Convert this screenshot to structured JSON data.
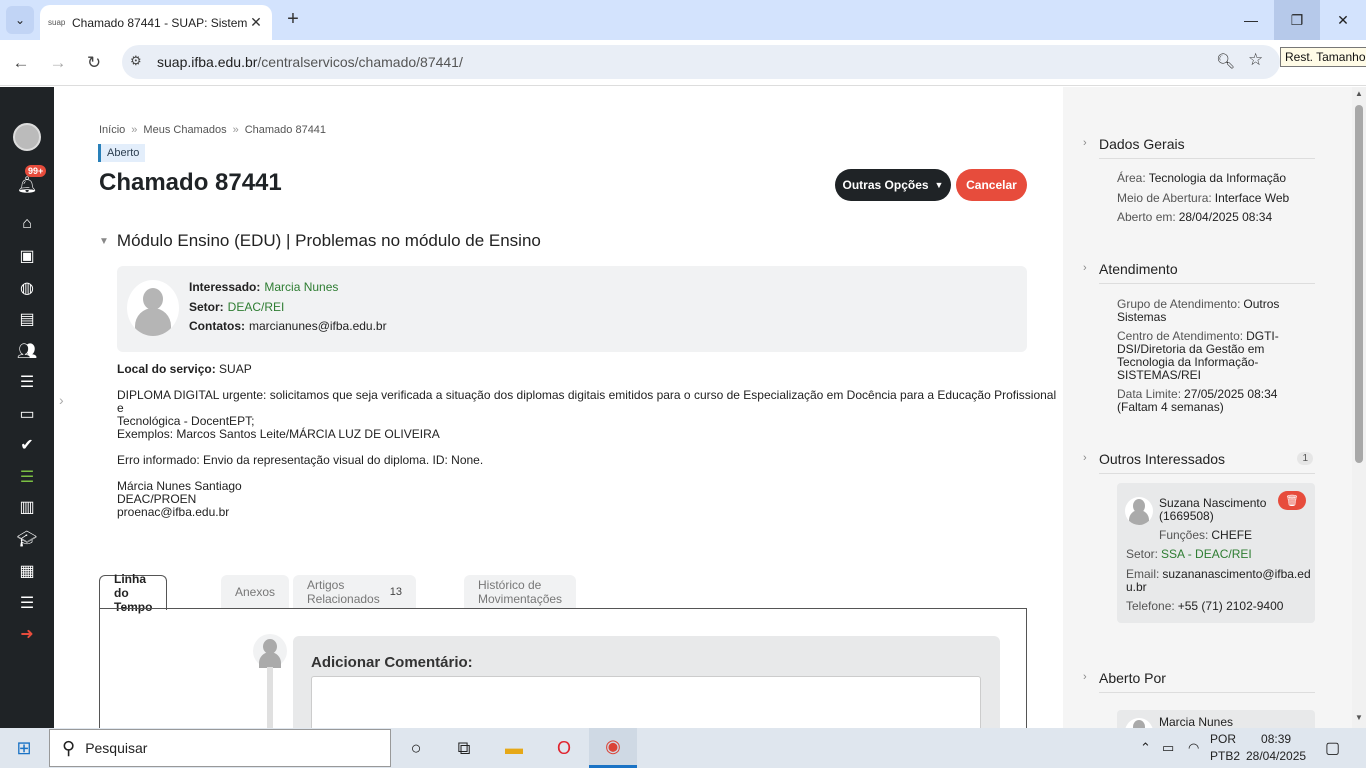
{
  "browser": {
    "tab_title": "Chamado 87441 - SUAP: Sistem",
    "favicon_text": "suap",
    "url_host": "suap.ifba.edu.br",
    "url_path": "/centralservicos/chamado/87441/",
    "tooltip": "Rest. Tamanho"
  },
  "sidebar": {
    "notification_badge": "99+"
  },
  "breadcrumb": {
    "items": [
      "Início",
      "Meus Chamados",
      "Chamado 87441"
    ]
  },
  "status": "Aberto",
  "title": "Chamado 87441",
  "actions": {
    "options_label": "Outras Opções",
    "cancel_label": "Cancelar"
  },
  "section_title": "Módulo Ensino (EDU) | Problemas no módulo de Ensino",
  "requester": {
    "interessado_label": "Interessado:",
    "interessado": "Marcia Nunes",
    "setor_label": "Setor:",
    "setor": "DEAC/REI",
    "contatos_label": "Contatos:",
    "contatos": "marcianunes@ifba.edu.br"
  },
  "description": {
    "local_label": "Local do serviço:",
    "local": "SUAP",
    "p1_line1": "DIPLOMA DIGITAL urgente: solicitamos que seja verificada a situação dos diplomas digitais emitidos para o curso de Especialização em Docência para a Educação Profissional e",
    "p1_line2": "Tecnológica - DocentEPT;",
    "p2": "Exemplos: Marcos Santos Leite/MÁRCIA LUZ DE OLIVEIRA",
    "p3": "Erro informado: Envio da representação visual do diploma. ID: None.",
    "sig1": "Márcia Nunes Santiago",
    "sig2": "DEAC/PROEN",
    "sig3": "proenac@ifba.edu.br"
  },
  "tabs": [
    {
      "label": "Linha do Tempo"
    },
    {
      "label": "Anexos"
    },
    {
      "label": "Artigos Relacionados",
      "count": "13"
    },
    {
      "label": "Histórico de Movimentações"
    }
  ],
  "comment": {
    "title": "Adicionar Comentário:"
  },
  "right_panel": {
    "dados_gerais": {
      "title": "Dados Gerais",
      "area_label": "Área:",
      "area": "Tecnologia da Informação",
      "meio_label": "Meio de Abertura:",
      "meio": "Interface Web",
      "aberto_label": "Aberto em:",
      "aberto": "28/04/2025 08:34"
    },
    "atendimento": {
      "title": "Atendimento",
      "grupo_label": "Grupo de Atendimento:",
      "grupo_l1": "Outros",
      "grupo_l2": "Sistemas",
      "centro_label": "Centro de Atendimento:",
      "centro_l1": "DGTI-",
      "centro_l2": "DSI/Diretoria da Gestão em",
      "centro_l3": "Tecnologia da Informação-",
      "centro_l4": "SISTEMAS/REI",
      "limite_label": "Data Limite:",
      "limite": "27/05/2025 08:34",
      "limite_note": "(Faltam 4 semanas)"
    },
    "outros": {
      "title": "Outros Interessados",
      "count": "1",
      "name": "Suzana Nascimento",
      "id": "(1669508)",
      "funcoes_label": "Funções:",
      "funcoes": "CHEFE",
      "setor_label": "Setor:",
      "setor": "SSA - DEAC/REI",
      "email_label": "Email:",
      "email_l1": "suzananascimento@ifba.ed",
      "email_l2": "u.br",
      "telefone_label": "Telefone:",
      "telefone": "+55 (71) 2102-9400"
    },
    "aberto_por": {
      "title": "Aberto Por",
      "name": "Marcia Nunes"
    }
  },
  "taskbar": {
    "search_placeholder": "Pesquisar",
    "lang1": "POR",
    "lang2": "PTB2",
    "time": "08:39",
    "date": "28/04/2025"
  }
}
